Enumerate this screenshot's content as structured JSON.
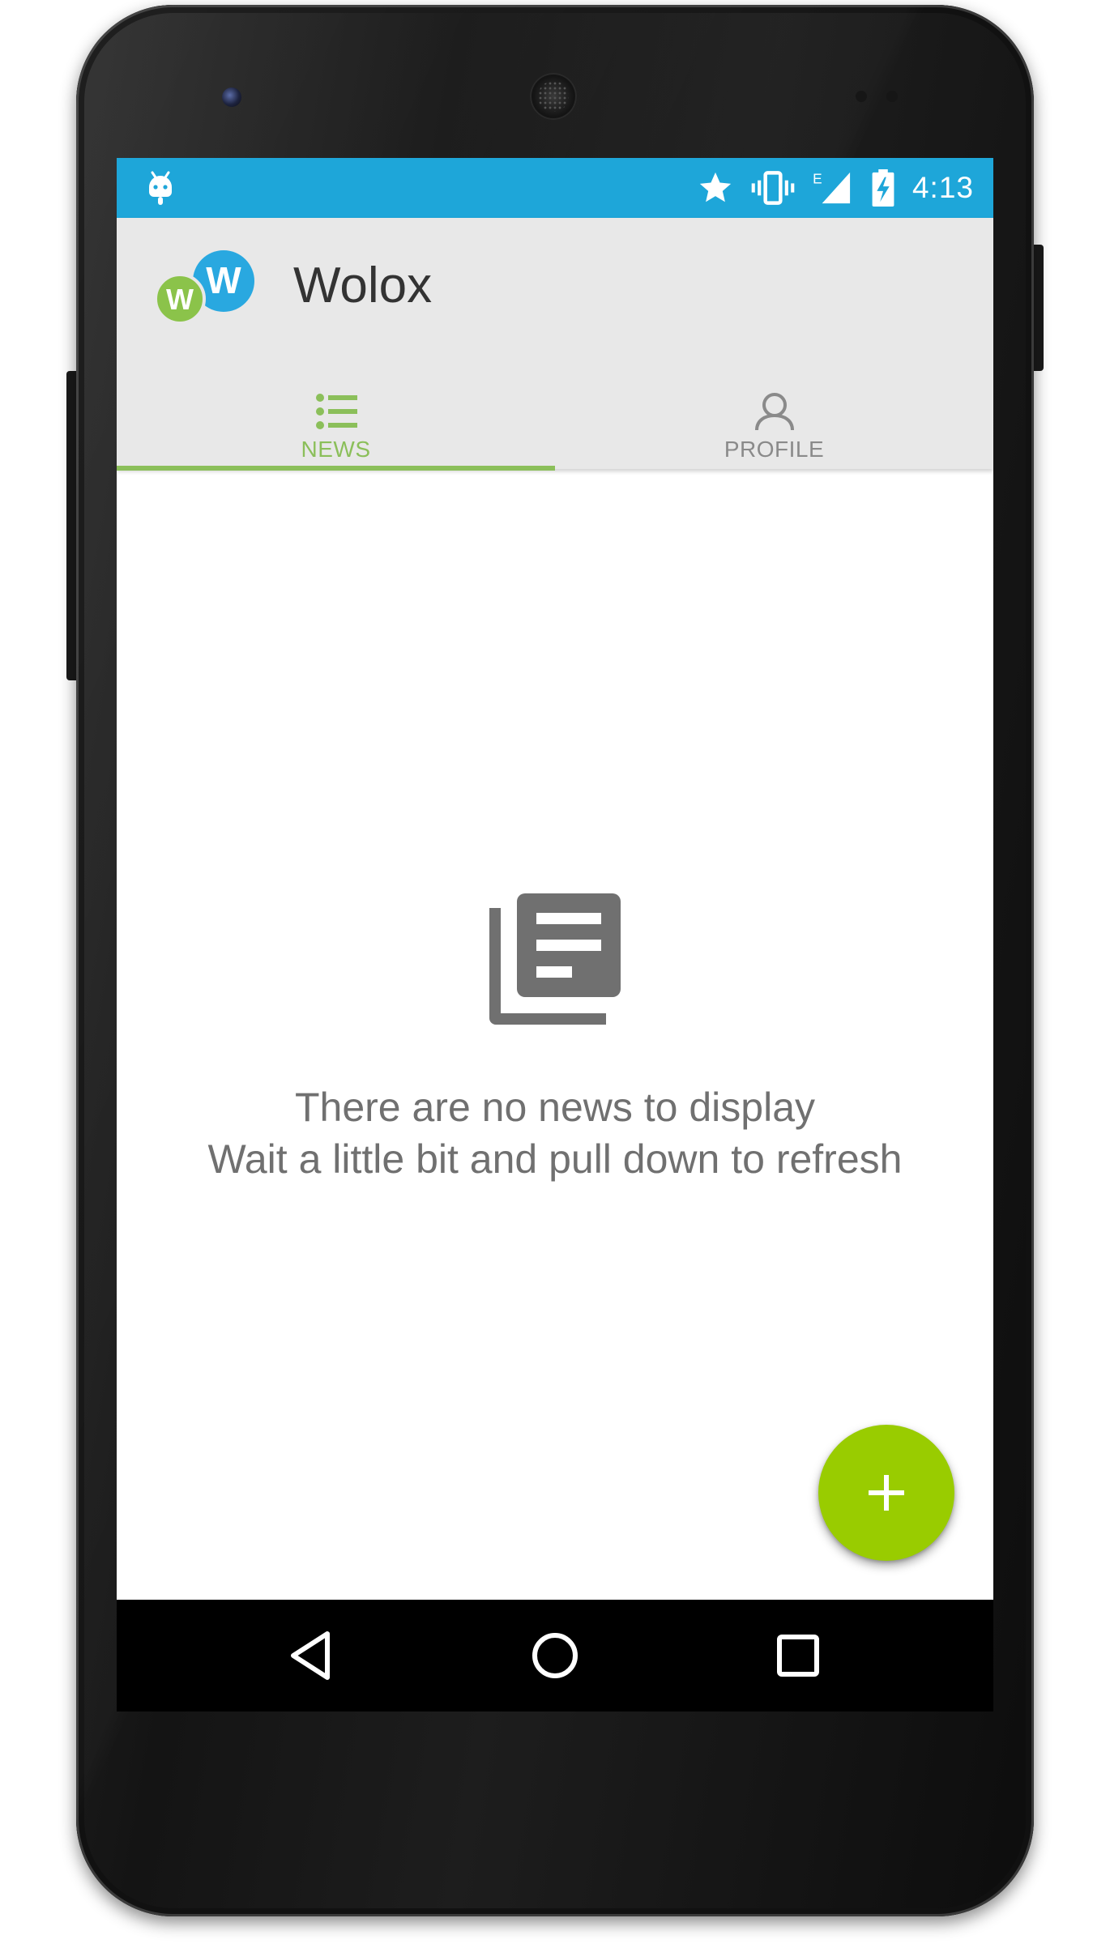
{
  "status_bar": {
    "time": "4:13",
    "background_color": "#1ea6d9",
    "icons": [
      "android-notification-icon",
      "star-icon",
      "vibrate-icon",
      "signal-edge-icon",
      "battery-charging-icon"
    ],
    "network_type": "E"
  },
  "app_bar": {
    "title": "Wolox",
    "logo_icon": "wolox-logo-icon",
    "logo_colors": {
      "green": "#8bc34a",
      "blue": "#29a8e0"
    }
  },
  "tabs": [
    {
      "label": "NEWS",
      "icon": "list-icon",
      "selected": true
    },
    {
      "label": "PROFILE",
      "icon": "person-icon",
      "selected": false
    }
  ],
  "accent_color": "#8bbf5a",
  "empty_state": {
    "icon": "news-icon",
    "line1": "There are no news to display",
    "line2": "Wait a little bit and pull down to refresh"
  },
  "fab": {
    "icon": "plus-icon",
    "color": "#99cc00"
  },
  "nav_bar": {
    "buttons": [
      "back-icon",
      "home-icon",
      "recents-icon"
    ]
  }
}
